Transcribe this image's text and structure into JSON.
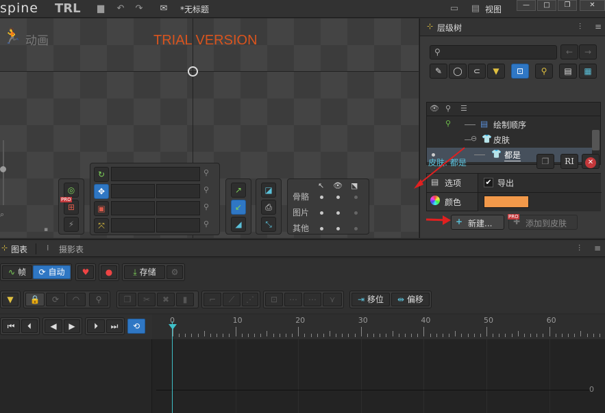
{
  "app": {
    "logo": "spine",
    "edition": "TRL",
    "file_title": "*无标题",
    "view_menu": "视图"
  },
  "viewport": {
    "mode_label": "动画",
    "trial_text": "TRIAL VERSION",
    "tools": {
      "legend_headers": [
        "骨骼",
        "图片",
        "其他"
      ],
      "pro_badge": "PRO"
    }
  },
  "hierarchy": {
    "tab_label": "层级树",
    "search": {
      "value": "",
      "placeholder": ""
    },
    "tree": [
      {
        "label": "绘制顺序",
        "icon": "draw-order-icon"
      },
      {
        "label": "皮肤",
        "icon": "skins-icon"
      },
      {
        "label": "都是",
        "icon": "skin-icon",
        "selected": true
      }
    ],
    "selection_title": "皮肤: 都是",
    "props": {
      "options_label": "选项",
      "export_label": "导出",
      "export_checked": true,
      "color_label": "颜色",
      "color_value": "#f2994a"
    },
    "new_button": "新建...",
    "add_to_skin_button": "添加到皮肤",
    "pro_badge": "PRO"
  },
  "bottom": {
    "tabs": [
      {
        "label": "图表",
        "active": true
      },
      {
        "label": "摄影表",
        "active": false
      }
    ],
    "toolbar1": {
      "frame_label": "帧",
      "auto_label": "自动",
      "store_label": "存储"
    },
    "toolbar2": {
      "offset_label": "移位",
      "offset2_label": "偏移"
    },
    "ruler_ticks": [
      "0",
      "10",
      "20",
      "30",
      "40",
      "50",
      "60"
    ],
    "graph_zero_label": "0"
  },
  "colors": {
    "accent": "#2f77c4",
    "trial": "#d9541e",
    "timeline_cursor": "#3fc0c8"
  }
}
